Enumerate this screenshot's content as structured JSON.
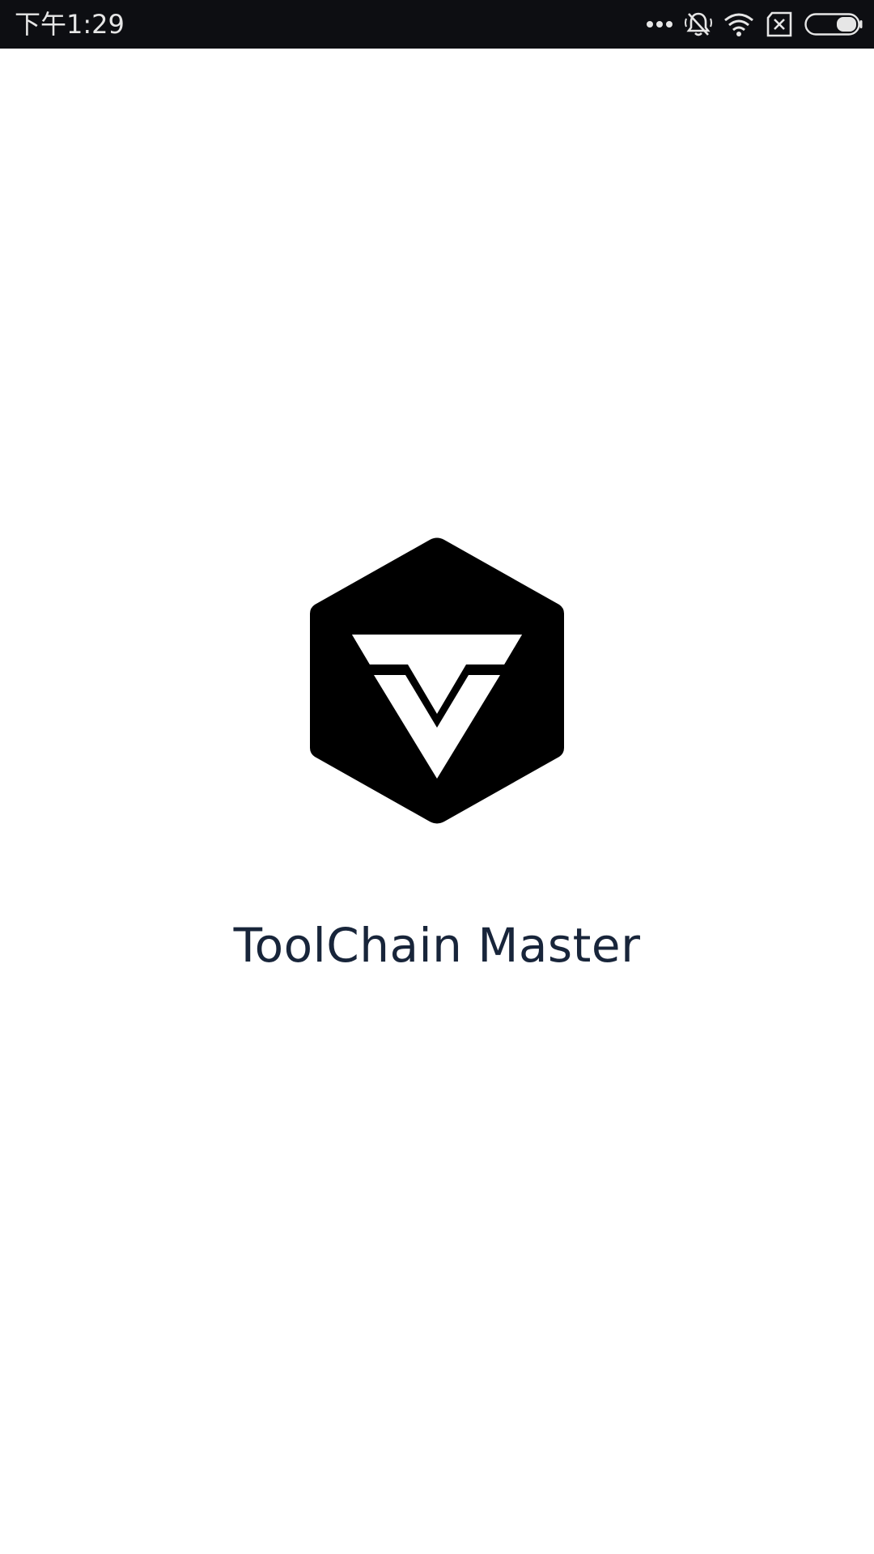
{
  "status_bar": {
    "time": "下午1:29",
    "icons": [
      "more-dots-icon",
      "bell-muted-icon",
      "wifi-icon",
      "sim-x-icon",
      "battery-icon"
    ],
    "background": "#0d0e12",
    "foreground": "#e6e6e6"
  },
  "splash": {
    "app_name": "ToolChain Master",
    "logo_icon": "hexagon-v-logo-icon",
    "logo_color": "#000000",
    "title_color": "#18253a"
  }
}
